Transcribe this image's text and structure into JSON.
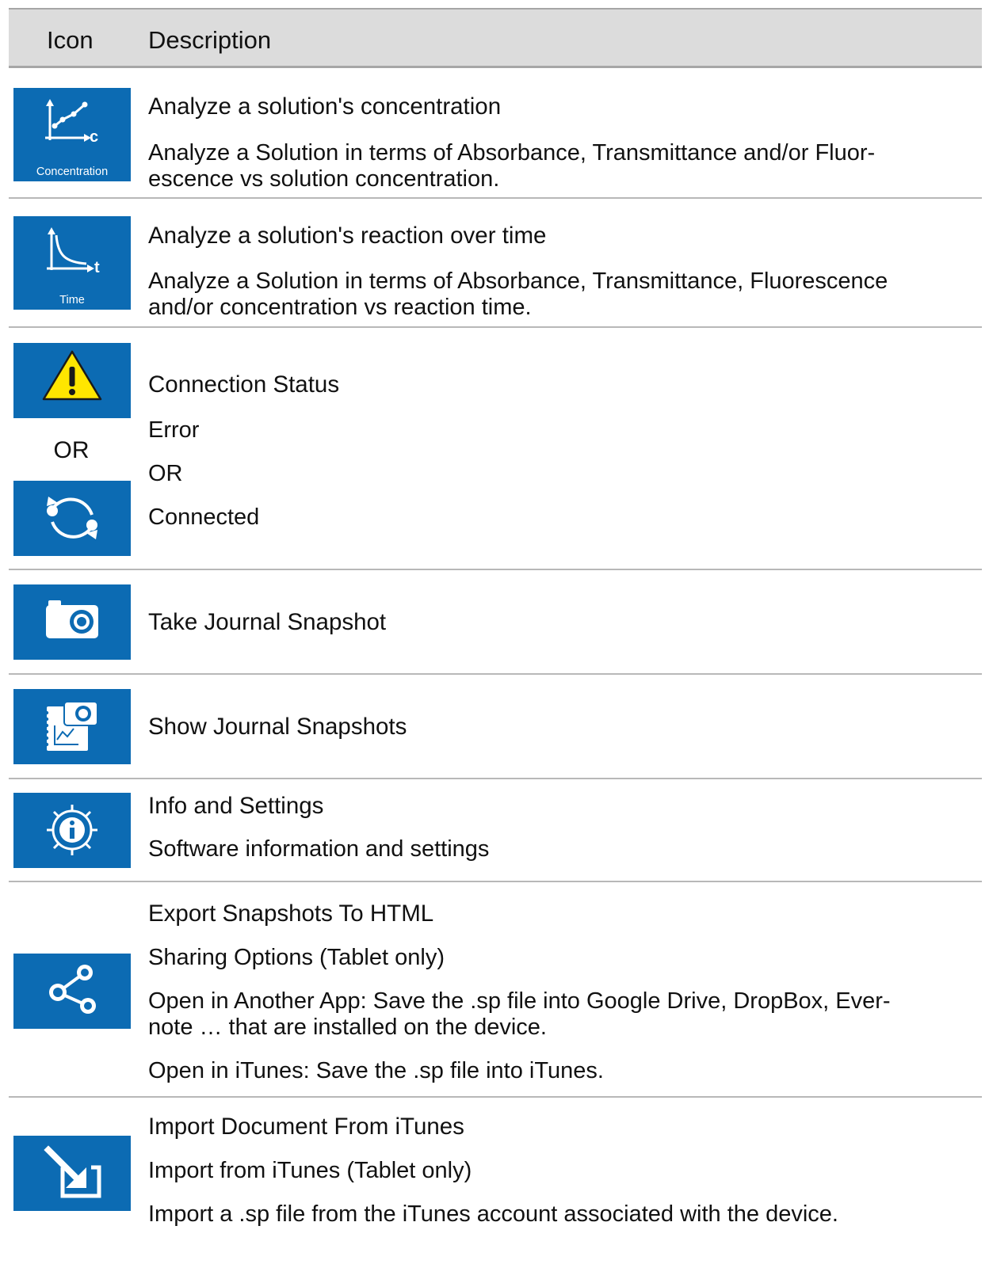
{
  "header": {
    "icon_col": "Icon",
    "description_col": "Description"
  },
  "rows": [
    {
      "icon": "concentration-chart-icon",
      "icon_caption": "Concentration",
      "title": "Analyze a solution's concentration",
      "lines": [
        "Analyze a Solution in terms of Absorbance, Transmittance and/or Fluor-\nescence vs solution concentration."
      ]
    },
    {
      "icon": "time-chart-icon",
      "icon_caption": "Time",
      "title": "Analyze a solution's reaction over time",
      "lines": [
        "Analyze a Solution in terms of Absorbance, Transmittance, Fluorescence\nand/or concentration vs reaction time."
      ]
    },
    {
      "icon": "warning-icon",
      "icon_alt": "sync-icon",
      "icon_or_label": "OR",
      "title": "Connection Status",
      "lines": [
        "Error",
        "OR",
        "Connected"
      ]
    },
    {
      "icon": "camera-icon",
      "title": "Take Journal Snapshot",
      "lines": []
    },
    {
      "icon": "journal-snapshots-icon",
      "title": "Show Journal Snapshots",
      "lines": []
    },
    {
      "icon": "info-gear-icon",
      "title": "Info and Settings",
      "lines": [
        "Software information and settings"
      ]
    },
    {
      "icon": "share-icon",
      "title": "Export Snapshots To HTML",
      "lines": [
        "Sharing Options (Tablet only)",
        "Open in Another App: Save the .sp file into Google Drive, DropBox, Ever-\nnote … that are installed on the device.",
        "Open in iTunes: Save the .sp file into iTunes."
      ]
    },
    {
      "icon": "import-arrow-icon",
      "title": "Import Document From iTunes",
      "lines": [
        "Import from iTunes (Tablet only)",
        "Import a .sp file from the iTunes account associated with the device."
      ]
    }
  ],
  "colors": {
    "tile_blue": "#0c6bb3",
    "header_bg": "#dcdcdc",
    "warning_yellow": "#ffe600"
  }
}
